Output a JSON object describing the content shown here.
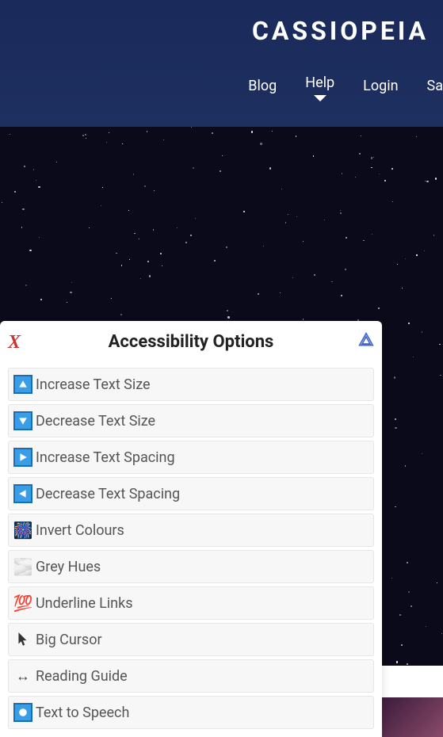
{
  "header": {
    "logo": "CASSIOPEIA",
    "nav": {
      "blog": "Blog",
      "help": "Help",
      "login": "Login",
      "sample": "Sa"
    }
  },
  "panel": {
    "close_label": "X",
    "title": "Accessibility Options",
    "options": {
      "increase_text": "Increase Text Size",
      "decrease_text": "Decrease Text Size",
      "increase_spacing": "Increase Text Spacing",
      "decrease_spacing": "Decrease Text Spacing",
      "invert_colours": "Invert Colours",
      "grey_hues": "Grey Hues",
      "underline_links": "Underline Links",
      "big_cursor": "Big Cursor",
      "reading_guide": "Reading Guide",
      "text_to_speech": "Text to Speech"
    }
  },
  "colors": {
    "header_bg": "#1a2a5a",
    "accent_blue": "#3a9de8",
    "close_red": "#cc3333"
  }
}
